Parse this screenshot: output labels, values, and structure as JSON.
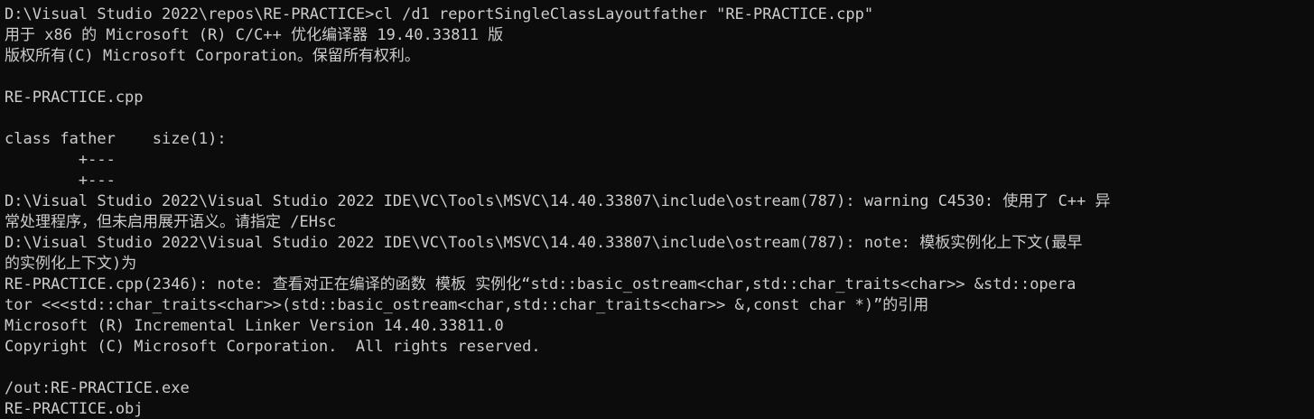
{
  "terminal": {
    "colors": {
      "background": "#0c0c0c",
      "foreground": "#cccccc"
    },
    "lines": [
      "D:\\Visual Studio 2022\\repos\\RE-PRACTICE>cl /d1 reportSingleClassLayoutfather \"RE-PRACTICE.cpp\"",
      "用于 x86 的 Microsoft (R) C/C++ 优化编译器 19.40.33811 版",
      "版权所有(C) Microsoft Corporation。保留所有权利。",
      "",
      "RE-PRACTICE.cpp",
      "",
      "class father    size(1):",
      "        +---",
      "        +---",
      "D:\\Visual Studio 2022\\Visual Studio 2022 IDE\\VC\\Tools\\MSVC\\14.40.33807\\include\\ostream(787): warning C4530: 使用了 C++ 异",
      "常处理程序，但未启用展开语义。请指定 /EHsc",
      "D:\\Visual Studio 2022\\Visual Studio 2022 IDE\\VC\\Tools\\MSVC\\14.40.33807\\include\\ostream(787): note: 模板实例化上下文(最早",
      "的实例化上下文)为",
      "RE-PRACTICE.cpp(2346): note: 查看对正在编译的函数 模板 实例化“std::basic_ostream<char,std::char_traits<char>> &std::opera",
      "tor <<<std::char_traits<char>>(std::basic_ostream<char,std::char_traits<char>> &,const char *)”的引用",
      "Microsoft (R) Incremental Linker Version 14.40.33811.0",
      "Copyright (C) Microsoft Corporation.  All rights reserved.",
      "",
      "/out:RE-PRACTICE.exe",
      "RE-PRACTICE.obj"
    ]
  }
}
